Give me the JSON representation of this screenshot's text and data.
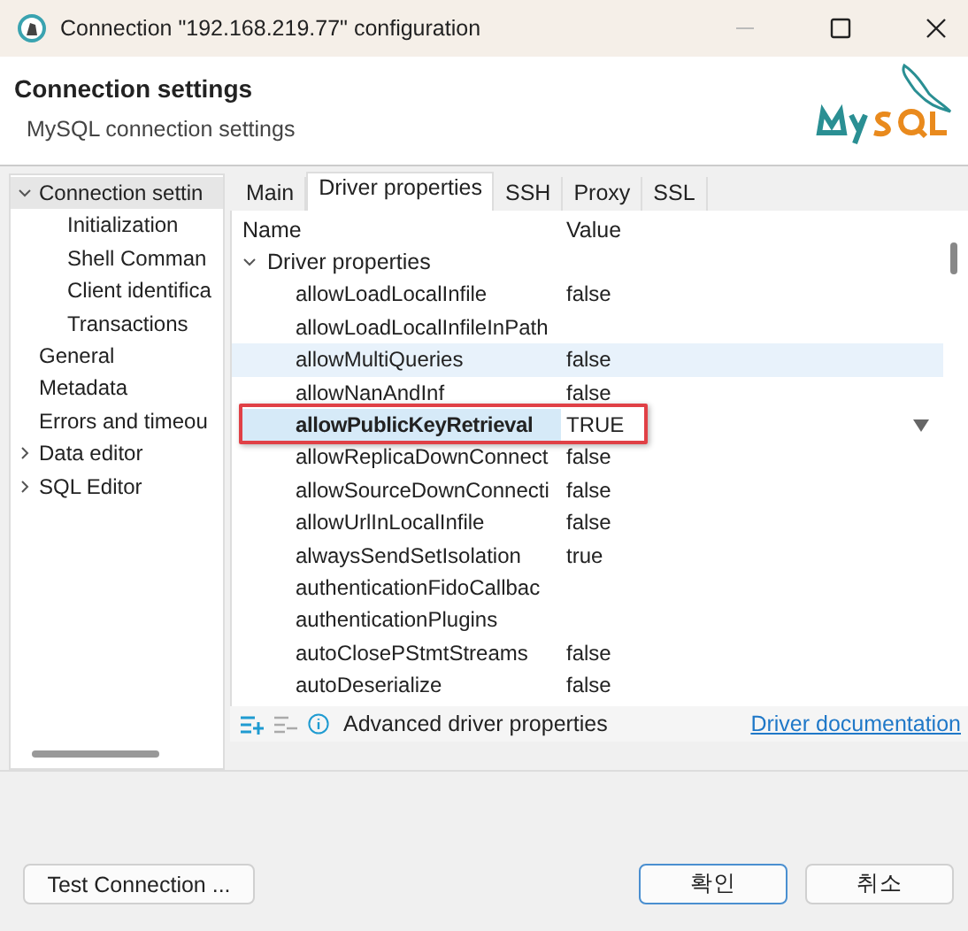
{
  "window": {
    "title": "Connection \"192.168.219.77\" configuration"
  },
  "header": {
    "title": "Connection settings",
    "subtitle": "MySQL connection settings"
  },
  "sidebar": {
    "items": [
      {
        "label": "Connection settin",
        "expanded": true,
        "selected": true,
        "children": [
          {
            "label": "Initialization",
            "selected": false
          },
          {
            "label": "Shell Comman",
            "selected": false
          },
          {
            "label": "Client identifica",
            "selected": false
          },
          {
            "label": "Transactions",
            "selected": false
          }
        ]
      },
      {
        "label": "General",
        "selected": false
      },
      {
        "label": "Metadata",
        "selected": false
      },
      {
        "label": "Errors and timeou",
        "selected": false
      },
      {
        "label": "Data editor",
        "expandable": true,
        "expanded": false,
        "selected": false
      },
      {
        "label": "SQL Editor",
        "expandable": true,
        "expanded": false,
        "selected": false
      }
    ]
  },
  "tabs": [
    {
      "label": "Main",
      "selected": false
    },
    {
      "label": "Driver properties",
      "selected": true
    },
    {
      "label": "SSH",
      "selected": false
    },
    {
      "label": "Proxy",
      "selected": false
    },
    {
      "label": "SSL",
      "selected": false
    }
  ],
  "table": {
    "columns": [
      "Name",
      "Value"
    ],
    "group": {
      "label": "Driver properties",
      "expanded": true
    },
    "rows": [
      {
        "name": "allowLoadLocalInfile",
        "value": "false",
        "selected": false,
        "editing": false
      },
      {
        "name": "allowLoadLocalInfileInPath",
        "selected": false,
        "editing": false
      },
      {
        "name": "allowMultiQueries",
        "value": "false",
        "selected": true,
        "editing": false
      },
      {
        "name": "allowNanAndInf",
        "value": "false",
        "selected": false,
        "editing": false
      },
      {
        "name": "allowPublicKeyRetrieval",
        "value": "TRUE",
        "selected": false,
        "editing": true,
        "annotated": true
      },
      {
        "name": "allowReplicaDownConnect",
        "value": "false",
        "selected": false,
        "editing": false
      },
      {
        "name": "allowSourceDownConnecti",
        "value": "false",
        "selected": false,
        "editing": false
      },
      {
        "name": "allowUrlInLocalInfile",
        "value": "false",
        "selected": false,
        "editing": false
      },
      {
        "name": "alwaysSendSetIsolation",
        "value": "true",
        "selected": false,
        "editing": false
      },
      {
        "name": "authenticationFidoCallbac",
        "selected": false,
        "editing": false
      },
      {
        "name": "authenticationPlugins",
        "selected": false,
        "editing": false
      },
      {
        "name": "autoClosePStmtStreams",
        "value": "false",
        "selected": false,
        "editing": false
      },
      {
        "name": "autoDeserialize",
        "value": "false",
        "selected": false,
        "editing": false
      }
    ]
  },
  "panel_footer": {
    "info": "Advanced driver properties",
    "link": "Driver documentation"
  },
  "buttons": {
    "test": "Test Connection ...",
    "ok": "확인",
    "cancel": "취소"
  }
}
